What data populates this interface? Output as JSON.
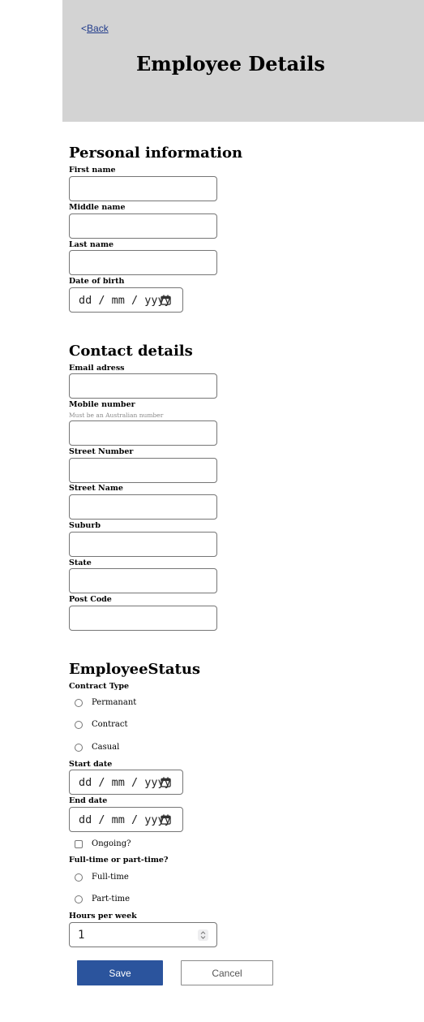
{
  "header": {
    "back_prefix": "<",
    "back_label": "Back",
    "title": "Employee Details"
  },
  "personal": {
    "title": "Personal information",
    "first_name_label": "First name",
    "first_name_value": "",
    "middle_name_label": "Middle name",
    "middle_name_value": "",
    "last_name_label": "Last name",
    "last_name_value": "",
    "dob_label": "Date of birth",
    "dob_placeholder": "dd / mm / yyyy"
  },
  "contact": {
    "title": "Contact details",
    "email_label": "Email adress",
    "mobile_label": "Mobile number",
    "mobile_hint": "Must be an Australian number",
    "street_number_label": "Street Number",
    "street_name_label": "Street Name",
    "suburb_label": "Suburb",
    "state_label": "State",
    "postcode_label": "Post Code"
  },
  "status": {
    "title": "EmployeeStatus",
    "contract_type_label": "Contract Type",
    "contract_options": [
      "Permanant",
      "Contract",
      "Casual"
    ],
    "start_date_label": "Start date",
    "start_date_placeholder": "dd / mm / yyyy",
    "end_date_label": "End date",
    "end_date_placeholder": "dd / mm / yyyy",
    "ongoing_label": "Ongoing?",
    "ft_pt_label": "Full-time or part-time?",
    "ft_pt_options": [
      "Full-time",
      "Part-time"
    ],
    "hours_label": "Hours per week",
    "hours_value": "1"
  },
  "actions": {
    "save_label": "Save",
    "cancel_label": "Cancel"
  },
  "colors": {
    "header_bg": "#d3d3d3",
    "save_bg": "#2b549d",
    "link": "#1f3a8a"
  },
  "icons": {
    "calendar": "calendar-icon",
    "spinner": "spinner-icon"
  }
}
